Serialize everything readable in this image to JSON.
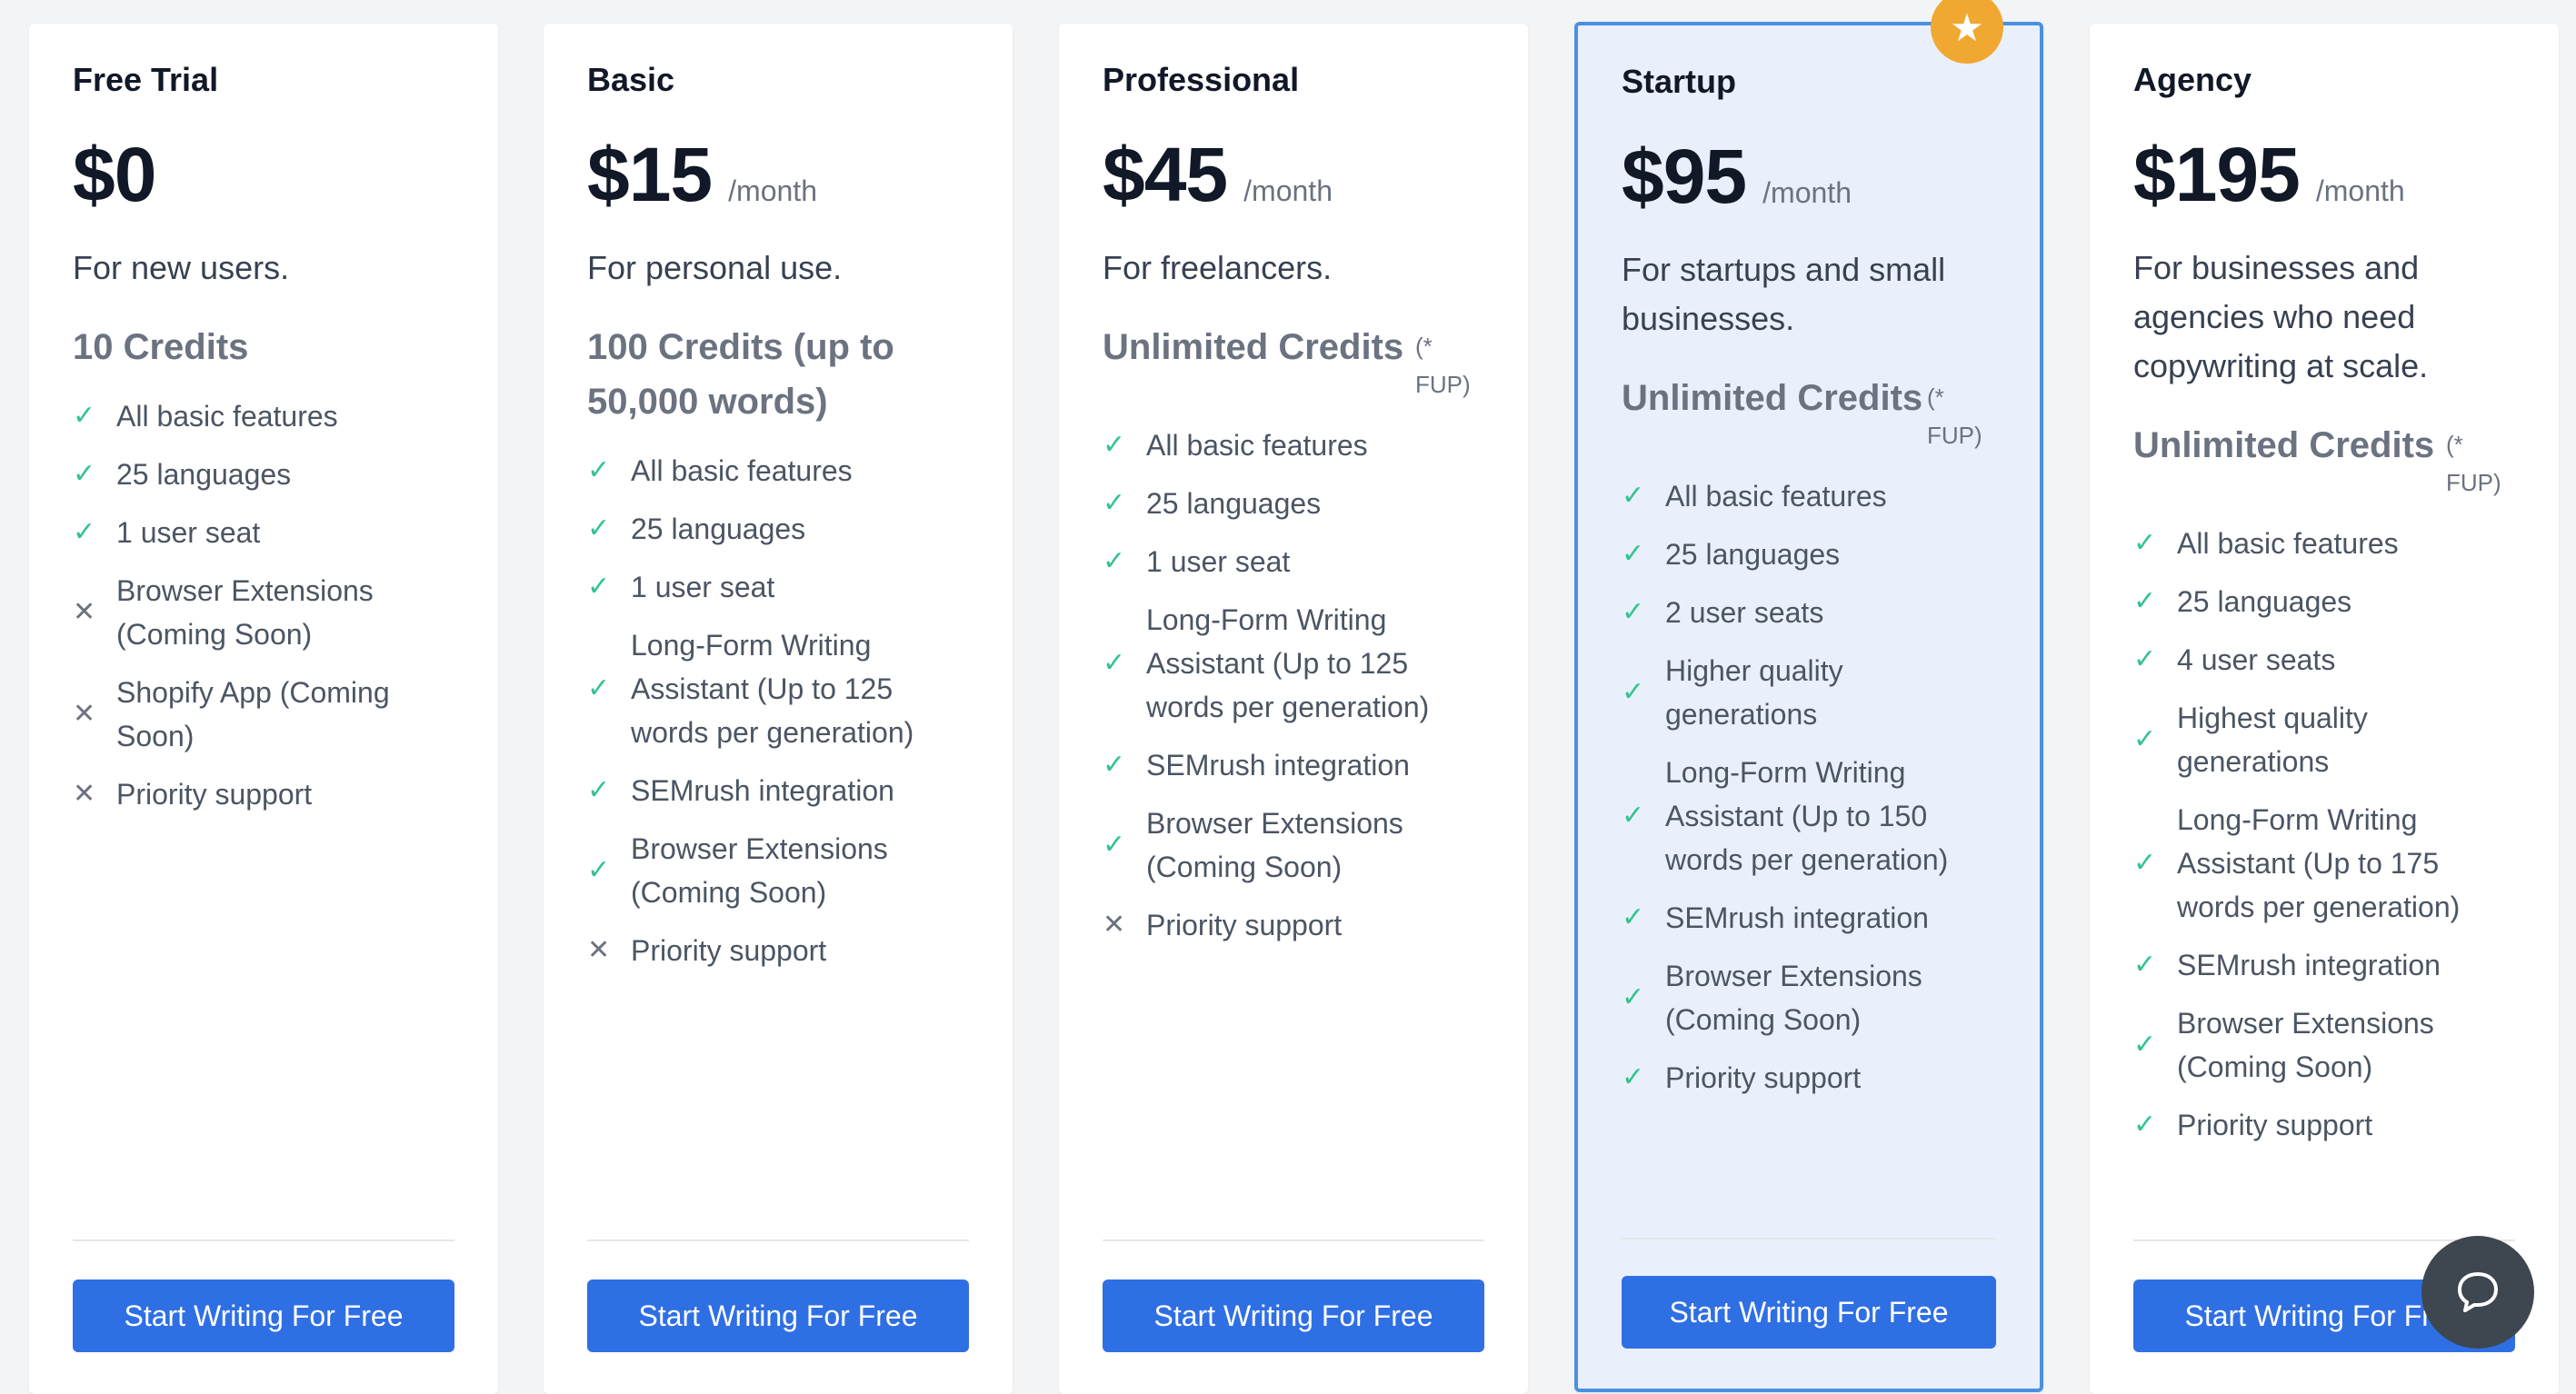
{
  "plans": [
    {
      "name": "Free Trial",
      "price": "$0",
      "period": "",
      "description": "For new users.",
      "credits": "10 Credits",
      "fup": "",
      "features": [
        {
          "text": "All basic features",
          "included": true
        },
        {
          "text": "25 languages",
          "included": true
        },
        {
          "text": "1 user seat",
          "included": true
        },
        {
          "text": "Browser Extensions (Coming Soon)",
          "included": false
        },
        {
          "text": "Shopify App (Coming Soon)",
          "included": false
        },
        {
          "text": "Priority support",
          "included": false
        }
      ],
      "cta": "Start Writing For Free"
    },
    {
      "name": "Basic",
      "price": "$15",
      "period": "/month",
      "description": "For personal use.",
      "credits": "100 Credits (up to 50,000 words)",
      "fup": "",
      "features": [
        {
          "text": "All basic features",
          "included": true
        },
        {
          "text": "25 languages",
          "included": true
        },
        {
          "text": "1 user seat",
          "included": true
        },
        {
          "text": "Long-Form Writing Assistant (Up to 125 words per generation)",
          "included": true
        },
        {
          "text": "SEMrush integration",
          "included": true
        },
        {
          "text": "Browser Extensions (Coming Soon)",
          "included": true
        },
        {
          "text": "Priority support",
          "included": false
        }
      ],
      "cta": "Start Writing For Free"
    },
    {
      "name": "Professional",
      "price": "$45",
      "period": "/month",
      "description": "For freelancers.",
      "credits": "Unlimited Credits",
      "fup": "(* FUP)",
      "features": [
        {
          "text": "All basic features",
          "included": true
        },
        {
          "text": "25 languages",
          "included": true
        },
        {
          "text": "1 user seat",
          "included": true
        },
        {
          "text": "Long-Form Writing Assistant (Up to 125 words per generation)",
          "included": true
        },
        {
          "text": "SEMrush integration",
          "included": true
        },
        {
          "text": "Browser Extensions (Coming Soon)",
          "included": true
        },
        {
          "text": "Priority support",
          "included": false
        }
      ],
      "cta": "Start Writing For Free"
    },
    {
      "name": "Startup",
      "price": "$95",
      "period": "/month",
      "description": "For startups and small businesses.",
      "credits": "Unlimited Credits",
      "fup": "(* FUP)",
      "featured": true,
      "features": [
        {
          "text": "All basic features",
          "included": true
        },
        {
          "text": "25 languages",
          "included": true
        },
        {
          "text": "2 user seats",
          "included": true
        },
        {
          "text": "Higher quality generations",
          "included": true
        },
        {
          "text": "Long-Form Writing Assistant (Up to 150 words per generation)",
          "included": true
        },
        {
          "text": "SEMrush integration",
          "included": true
        },
        {
          "text": "Browser Extensions (Coming Soon)",
          "included": true
        },
        {
          "text": "Priority support",
          "included": true
        }
      ],
      "cta": "Start Writing For Free"
    },
    {
      "name": "Agency",
      "price": "$195",
      "period": "/month",
      "description": "For businesses and agencies who need copywriting at scale.",
      "credits": "Unlimited Credits",
      "fup": "(* FUP)",
      "features": [
        {
          "text": "All basic features",
          "included": true
        },
        {
          "text": "25 languages",
          "included": true
        },
        {
          "text": "4 user seats",
          "included": true
        },
        {
          "text": "Highest quality generations",
          "included": true
        },
        {
          "text": "Long-Form Writing Assistant (Up to 175 words per generation)",
          "included": true
        },
        {
          "text": "SEMrush integration",
          "included": true
        },
        {
          "text": "Browser Extensions (Coming Soon)",
          "included": true
        },
        {
          "text": "Priority support",
          "included": true
        }
      ],
      "cta": "Start Writing For Free"
    }
  ],
  "icons": {
    "included": "check-icon",
    "excluded": "x-icon",
    "featured": "star-icon",
    "chat": "chat-icon"
  },
  "colors": {
    "accent": "#2f6fe4",
    "check": "#34c38f",
    "badge": "#f0a830",
    "featured_bg": "#e9f0fb",
    "featured_border": "#4a90e2"
  }
}
